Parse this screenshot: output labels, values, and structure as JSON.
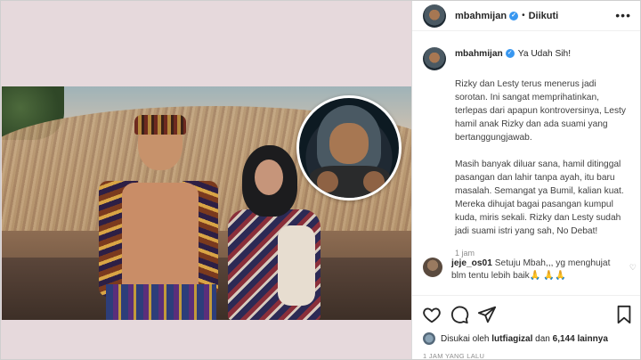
{
  "post": {
    "username": "mbahmijan",
    "verified_glyph": "✓",
    "follow_status": "Diikuti",
    "separator": "•",
    "more_label": "•••"
  },
  "caption": {
    "username": "mbahmijan",
    "lead": "Ya Udah Sih!",
    "paragraph1": "Rizky dan Lesty terus menerus jadi sorotan. Ini sangat memprihatinkan, terlepas dari apapun kontroversinya, Lesty hamil anak Rizky dan ada suami yang bertanggungjawab.",
    "paragraph2": "Masih banyak diluar sana, hamil ditinggal pasangan dan lahir tanpa ayah, itu baru masalah. Semangat ya Bumil, kalian kuat. Mereka dihujat bagai pasangan kumpul kuda, miris sekali. Rizky dan Lesty sudah jadi suami istri yang sah, No Debat!",
    "time": "1 jam"
  },
  "comment": {
    "username": "jeje_os01",
    "text": "Setuju Mbah,,, yg menghujat blm tentu lebih baik🙏 🙏🙏",
    "like_glyph": "♡"
  },
  "likes": {
    "prefix": "Disukai oleh",
    "user": "lutfiagizal",
    "connector": "dan",
    "count": "6,144 lainnya"
  },
  "footer": {
    "ago": "1 JAM YANG LALU"
  },
  "icons": [
    "heart-icon",
    "comment-icon",
    "share-icon",
    "bookmark-icon"
  ],
  "colors": {
    "verified": "#3897f0",
    "media_background": "#e6d9dc"
  }
}
